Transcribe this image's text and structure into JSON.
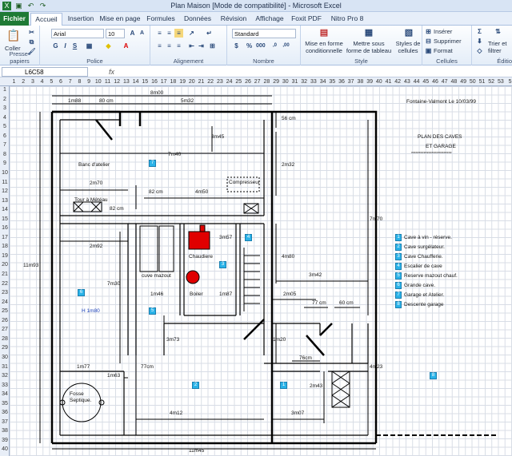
{
  "window": {
    "title": "Plan Maison  [Mode de compatibilité]  -  Microsoft Excel"
  },
  "ribbon_tabs": [
    "Fichier",
    "Accueil",
    "Insertion",
    "Mise en page",
    "Formules",
    "Données",
    "Révision",
    "Affichage",
    "Foxit PDF",
    "Nitro Pro 8"
  ],
  "ribbon": {
    "coller": "Coller",
    "presse_papiers": "Presse-papiers",
    "font_name": "Arial",
    "font_size": "10",
    "police": "Police",
    "alignement": "Alignement",
    "number_format": "Standard",
    "nombre": "Nombre",
    "mise_en_forme": "Mise en forme conditionnelle",
    "mettre_sous_forme": "Mettre sous forme de tableau",
    "styles_cellules": "Styles de cellules",
    "style": "Style",
    "inserer": "Insérer",
    "supprimer": "Supprimer",
    "format": "Format",
    "cellules": "Cellules",
    "trier": "Trier et filtrer",
    "edition": "Éditio"
  },
  "formula_bar": {
    "name_box": "L6C58",
    "fx": "fx",
    "content": ""
  },
  "columns": [
    "1",
    "2",
    "3",
    "4",
    "5",
    "6",
    "7",
    "8",
    "9",
    "10",
    "11",
    "12",
    "13",
    "14",
    "15",
    "16",
    "17",
    "18",
    "19",
    "20",
    "21",
    "22",
    "23",
    "24",
    "25",
    "26",
    "27",
    "28",
    "29",
    "30",
    "31",
    "32",
    "33",
    "34",
    "35",
    "36",
    "37",
    "38",
    "39",
    "40",
    "41",
    "42",
    "43",
    "44",
    "45",
    "46",
    "47",
    "48",
    "49",
    "50",
    "51",
    "52",
    "53",
    "5"
  ],
  "rows": [
    "1",
    "2",
    "3",
    "4",
    "5",
    "6",
    "7",
    "8",
    "9",
    "10",
    "11",
    "12",
    "13",
    "14",
    "15",
    "16",
    "17",
    "18",
    "19",
    "20",
    "21",
    "22",
    "23",
    "24",
    "25",
    "26",
    "27",
    "28",
    "29",
    "30",
    "31",
    "32",
    "33",
    "34",
    "35",
    "36",
    "37",
    "38",
    "39",
    "40"
  ],
  "plan": {
    "header_text": "Fontaine-Valmont Le 10/03/99",
    "plan_title": "PLAN DES CAVES",
    "plan_subtitle": "ET GARAGE",
    "plan_underline": "**************************",
    "dims": [
      "8m00",
      "1m88",
      "80 cm",
      "5m32",
      "56 cm",
      "3m45",
      "7m40",
      "2m32",
      "2m70",
      "82 cm",
      "4m50",
      "82 cm",
      "7m70",
      "2m92",
      "3m57",
      "4m80",
      "11m93",
      "7m30",
      "1m46",
      "1m87",
      "3m42",
      "2m05",
      "77 cm",
      "60 cm",
      "3m73",
      "1m20",
      "76cm",
      "1m77",
      "1m63",
      "77cm",
      "2m43",
      "4m23",
      "4m12",
      "3m07",
      "11m45"
    ],
    "labels": {
      "banc": "Banc d'atelier",
      "compresseur": "Compresseur",
      "tour": "Tour à Météau",
      "chaudiere": "Chaudiere",
      "cuve": "cuve mazout",
      "boiler": "Boiler",
      "h": "H 1m80",
      "fosse1": "Fosse",
      "fosse2": "Septique."
    },
    "markers": [
      "7",
      "4",
      "3",
      "6",
      "5",
      "2",
      "1",
      "8"
    ]
  },
  "legend": [
    {
      "num": "1",
      "text": "Cave à vin - réserve."
    },
    {
      "num": "2",
      "text": "Cave surgélateur."
    },
    {
      "num": "3",
      "text": "Cave Chaufferie."
    },
    {
      "num": "4",
      "text": "Escalier de cave"
    },
    {
      "num": "5",
      "text": "Reserve mazout chauf."
    },
    {
      "num": "6",
      "text": "Grande cave."
    },
    {
      "num": "7",
      "text": "Garage et Atelier."
    },
    {
      "num": "8",
      "text": "Descente garage"
    }
  ]
}
